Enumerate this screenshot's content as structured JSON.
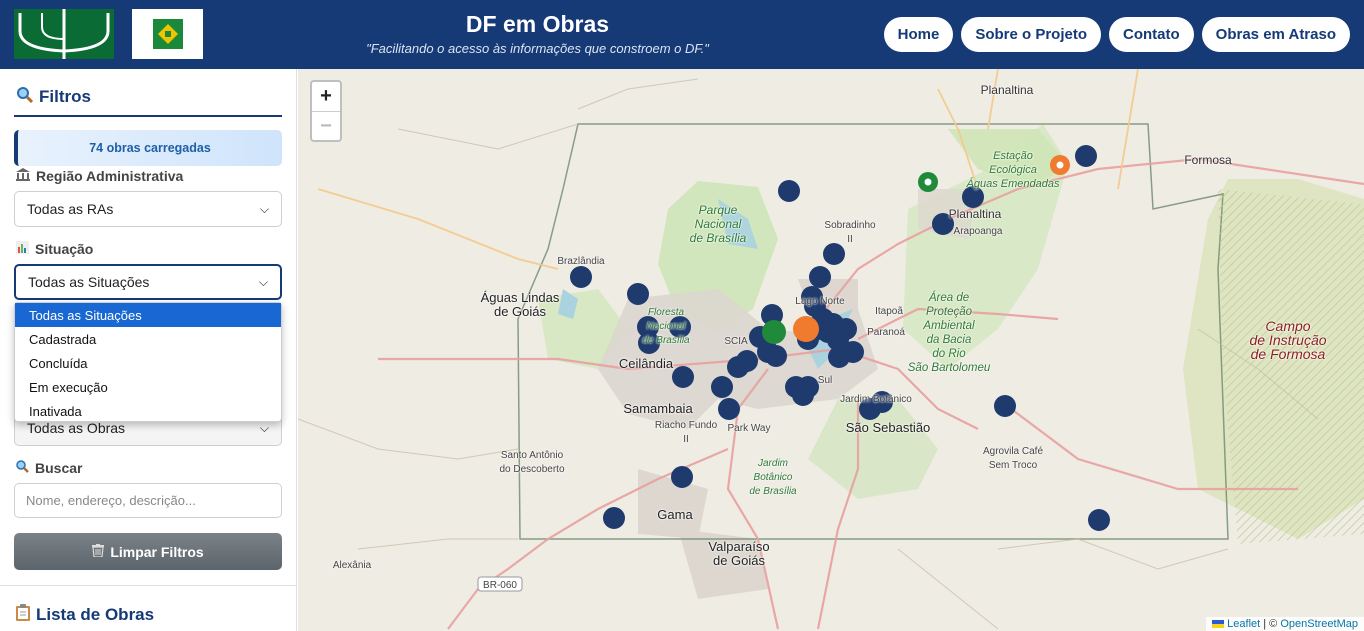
{
  "header": {
    "title": "DF em Obras",
    "subtitle": "\"Facilitando o acesso às informações que constroem o DF.\"",
    "nav": [
      "Home",
      "Sobre o Projeto",
      "Contato",
      "Obras em Atraso"
    ]
  },
  "sidebar": {
    "filters_title": "Filtros",
    "status_text": "74 obras carregadas",
    "ra_label": "Região Administrativa",
    "ra_value": "Todas as RAs",
    "situacao_label": "Situação",
    "situacao_value": "Todas as Situações",
    "situacao_options": [
      "Todas as Situações",
      "Cadastrada",
      "Concluída",
      "Em execução",
      "Inativada"
    ],
    "tipo_value": "Todas as Obras",
    "buscar_label": "Buscar",
    "search_placeholder": "Nome, endereço, descrição...",
    "clear_label": "Limpar Filtros",
    "list_title": "Lista de Obras"
  },
  "map": {
    "zoom_in": "+",
    "zoom_out": "−",
    "attribution_leaflet": "Leaflet",
    "attribution_sep": " | © ",
    "attribution_osm": "OpenStreetMap",
    "places": {
      "planaltina_top": "Planaltina",
      "formosa": "Formosa",
      "estacao": "Estação\nEcológica\nÁguas Emendadas",
      "planaltina": "Planaltina",
      "arapoanga": "Arapoanga",
      "sobradinho": "Sobradinho\nII",
      "parque": "Parque\nNacional\nde Brasília",
      "brazlandia": "Brazlândia",
      "aguas_lindas": "Águas Lindas\nde Goiás",
      "lago_norte": "Lago Norte",
      "itapoa": "Itapoã",
      "paranoa": "Paranoá",
      "apa": "Área de\nProteção\nAmbiental\nda Bacia\ndo Rio\nSão Bartolomeu",
      "campo": "Campo\nde Instrução\nde Formosa",
      "floresta": "Floresta\nNacional\nde Brasília",
      "scia": "SCIA",
      "ceilandia": "Ceilândia",
      "samambaia": "Samambaia",
      "riacho": "Riacho Fundo\nII",
      "park_way": "Park Way",
      "sul": "Sul",
      "jardim_botanico": "Jardim Botânico",
      "sao_sebastiao": "São Sebastião",
      "santo_antonio": "Santo Antônio\ndo Descoberto",
      "jardim_botanico_br": "Jardim\nBotânico\nde Brasília",
      "agrovila": "Agrovila Café\nSem Troco",
      "gama": "Gama",
      "valparaiso": "Valparaíso\nde Goiás",
      "alexania": "Alexânia",
      "br060": "BR-060"
    }
  }
}
